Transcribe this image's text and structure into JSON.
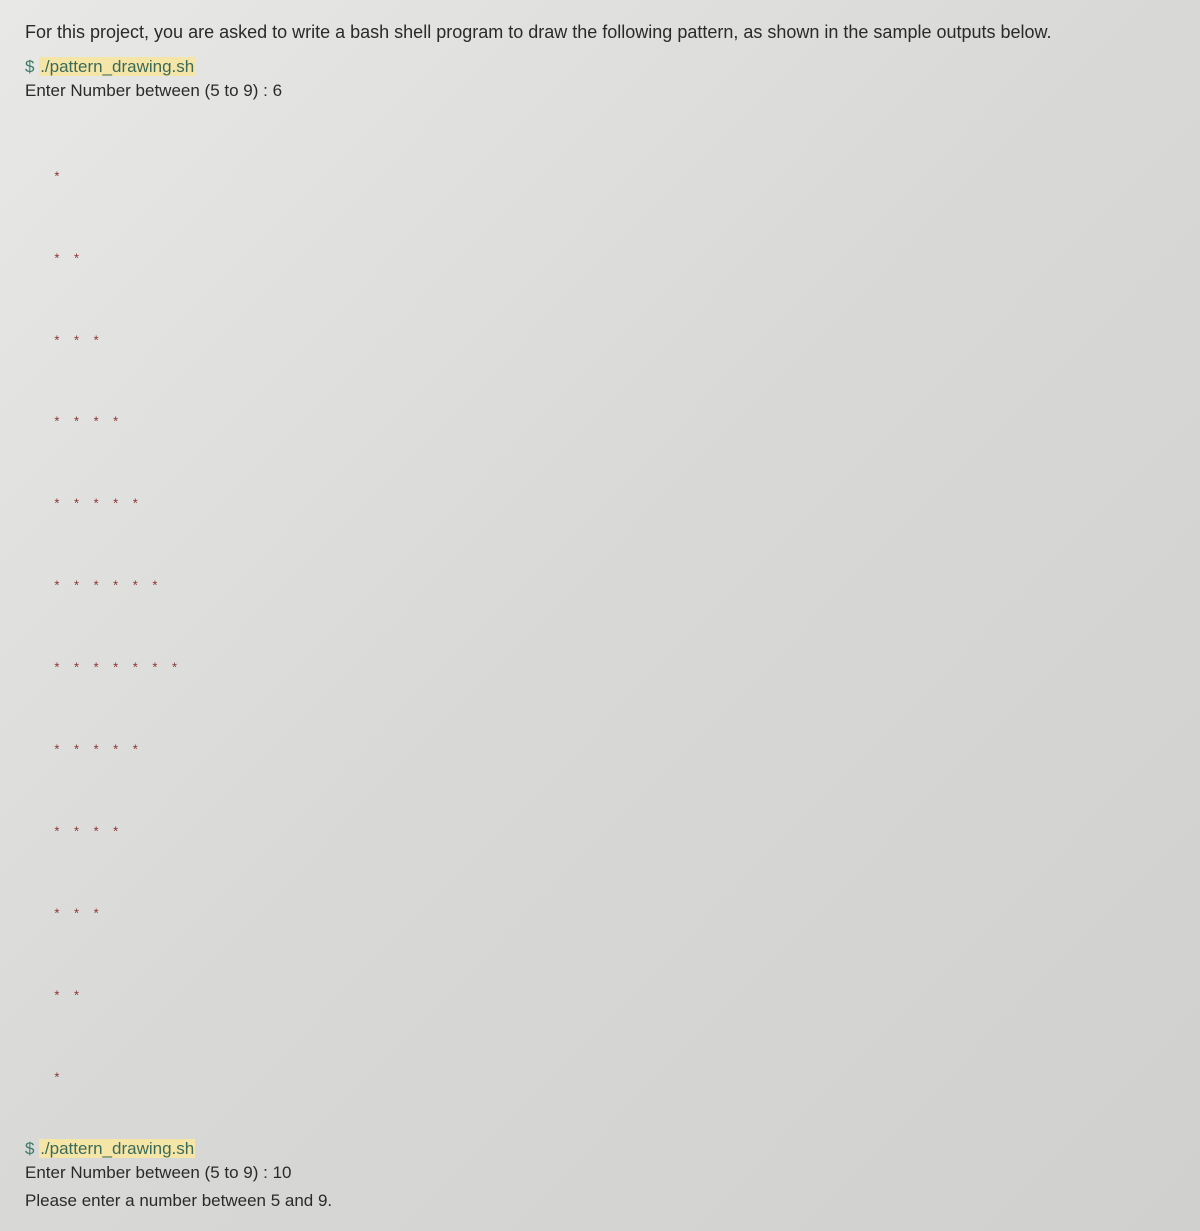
{
  "instruction": "For this project, you are asked to write a bash shell program to draw the following pattern, as shown in the sample outputs below.",
  "run1": {
    "prompt": "$ ",
    "script": "./pattern_drawing.sh",
    "input_label": "Enter Number between (5 to 9) : ",
    "input_value": "6",
    "pattern_lines": [
      "*",
      "* *",
      "* * *",
      "* * * *",
      "* * * * *",
      "* * * * * *",
      "* * * * * * *",
      "* * * * *",
      "* * * *",
      "* * *",
      "* *",
      "*"
    ]
  },
  "run2": {
    "prompt": "$ ",
    "script": "./pattern_drawing.sh",
    "input_label": "Enter Number between (5 to 9) : ",
    "input_value": "10",
    "error": "Please enter a  number between 5 and 9."
  }
}
